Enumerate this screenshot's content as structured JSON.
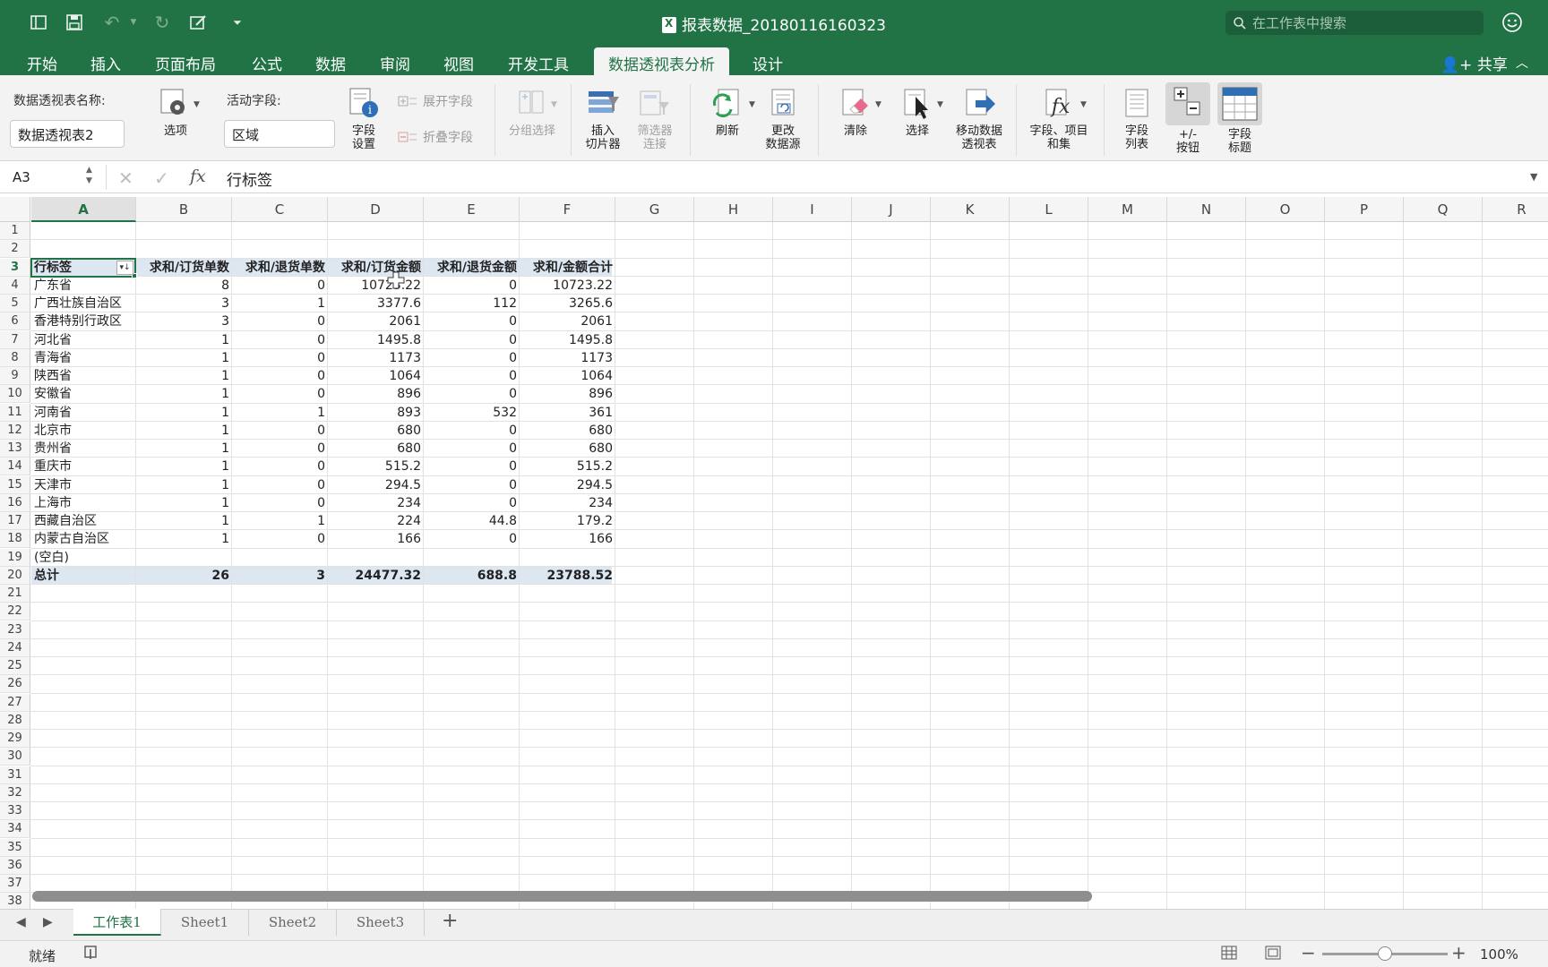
{
  "window": {
    "title": "报表数据_20180116160323",
    "search_placeholder": "在工作表中搜索"
  },
  "tabs": [
    {
      "label": "开始"
    },
    {
      "label": "插入"
    },
    {
      "label": "页面布局"
    },
    {
      "label": "公式"
    },
    {
      "label": "数据"
    },
    {
      "label": "审阅"
    },
    {
      "label": "视图"
    },
    {
      "label": "开发工具"
    },
    {
      "label": "数据透视表分析"
    },
    {
      "label": "设计"
    }
  ],
  "share_label": "共享",
  "ribbon": {
    "pivot_name_label": "数据透视表名称:",
    "pivot_name_value": "数据透视表2",
    "options": "选项",
    "active_field_label": "活动字段:",
    "active_field_value": "区域",
    "field_settings": [
      "字段",
      "设置"
    ],
    "expand_field": "展开字段",
    "collapse_field": "折叠字段",
    "group_selection": "分组选择",
    "insert_slicer": [
      "插入",
      "切片器"
    ],
    "filter_connections": [
      "筛选器",
      "连接"
    ],
    "refresh": "刷新",
    "change_source": [
      "更改",
      "数据源"
    ],
    "clear": "清除",
    "select": "选择",
    "move_pivot": [
      "移动数据",
      "透视表"
    ],
    "fields_items_sets": [
      "字段、项目",
      "和集"
    ],
    "field_list": [
      "字段",
      "列表"
    ],
    "buttons": [
      "+/-",
      "按钮"
    ],
    "field_headers": [
      "字段",
      "标题"
    ]
  },
  "formula_bar": {
    "name_box": "A3",
    "fx": "fx",
    "content": "行标签"
  },
  "columns": [
    "A",
    "B",
    "C",
    "D",
    "E",
    "F",
    "G",
    "H",
    "I",
    "J",
    "K",
    "L",
    "M",
    "N",
    "O",
    "P",
    "Q",
    "R"
  ],
  "rows": [
    "1",
    "2",
    "3",
    "4",
    "5",
    "6",
    "7",
    "8",
    "9",
    "10",
    "11",
    "12",
    "13",
    "14",
    "15",
    "16",
    "17",
    "18",
    "19",
    "20",
    "21",
    "22",
    "23",
    "24",
    "25",
    "26",
    "27",
    "28",
    "29",
    "30",
    "31",
    "32",
    "33",
    "34",
    "35",
    "36",
    "37",
    "38"
  ],
  "pivot": {
    "headers": [
      "行标签",
      "求和/订货单数",
      "求和/退货单数",
      "求和/订货金额",
      "求和/退货金额",
      "求和/金额合计"
    ],
    "rows": [
      [
        "广东省",
        "8",
        "0",
        "10723.22",
        "0",
        "10723.22"
      ],
      [
        "广西壮族自治区",
        "3",
        "1",
        "3377.6",
        "112",
        "3265.6"
      ],
      [
        "香港特别行政区",
        "3",
        "0",
        "2061",
        "0",
        "2061"
      ],
      [
        "河北省",
        "1",
        "0",
        "1495.8",
        "0",
        "1495.8"
      ],
      [
        "青海省",
        "1",
        "0",
        "1173",
        "0",
        "1173"
      ],
      [
        "陕西省",
        "1",
        "0",
        "1064",
        "0",
        "1064"
      ],
      [
        "安徽省",
        "1",
        "0",
        "896",
        "0",
        "896"
      ],
      [
        "河南省",
        "1",
        "1",
        "893",
        "532",
        "361"
      ],
      [
        "北京市",
        "1",
        "0",
        "680",
        "0",
        "680"
      ],
      [
        "贵州省",
        "1",
        "0",
        "680",
        "0",
        "680"
      ],
      [
        "重庆市",
        "1",
        "0",
        "515.2",
        "0",
        "515.2"
      ],
      [
        "天津市",
        "1",
        "0",
        "294.5",
        "0",
        "294.5"
      ],
      [
        "上海市",
        "1",
        "0",
        "234",
        "0",
        "234"
      ],
      [
        "西藏自治区",
        "1",
        "1",
        "224",
        "44.8",
        "179.2"
      ],
      [
        "内蒙古自治区",
        "1",
        "0",
        "166",
        "0",
        "166"
      ],
      [
        "(空白)",
        "",
        "",
        "",
        "",
        ""
      ]
    ],
    "total": [
      "总计",
      "26",
      "3",
      "24477.32",
      "688.8",
      "23788.52"
    ]
  },
  "sheets": [
    {
      "name": "工作表1",
      "active": true
    },
    {
      "name": "Sheet1",
      "active": false
    },
    {
      "name": "Sheet2",
      "active": false
    },
    {
      "name": "Sheet3",
      "active": false
    }
  ],
  "status": {
    "ready": "就绪",
    "zoom": "100%",
    "zoom_level": 0.5
  },
  "colors": {
    "brand": "#217346",
    "pivot_band": "#dde7f1"
  }
}
